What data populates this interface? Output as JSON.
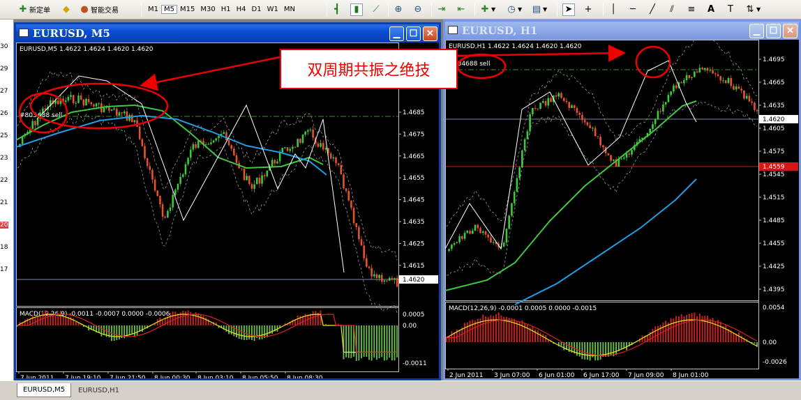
{
  "toolbar": {
    "new_order": "新定单",
    "expert": "智能交易",
    "timeframes": [
      "M1",
      "M5",
      "M15",
      "M30",
      "H1",
      "H4",
      "D1",
      "W1",
      "MN"
    ],
    "active_timeframe": "M5"
  },
  "left_strip": {
    "numbers": [
      "30",
      "29",
      "27",
      "26",
      "25",
      "23",
      "22",
      "21",
      "20",
      "18",
      "17"
    ]
  },
  "windows": [
    {
      "title": "EURUSD, M5",
      "info": "EURUSD,M5  1.4622 1.4624 1.4620 1.4620",
      "order_label": "#803",
      "order_label2": "688 sell",
      "price_axis": [
        "1.4685",
        "1.4675",
        "1.4665",
        "1.4655",
        "1.4645",
        "1.4635",
        "1.4625",
        "1.4615"
      ],
      "current_price": "1.4620",
      "macd_info": "MACD(12,26,9) -0.0011 -0.0007 0.0000 -0.0006",
      "macd_axis": [
        "0.0005",
        "0.00",
        "-0.0011"
      ],
      "time_axis": [
        "7 Jun 2011",
        "7 Jun 19:10",
        "7 Jun 21:50",
        "8 Jun 00:30",
        "8 Jun 03:10",
        "8 Jun 05:50",
        "8 Jun 08:30"
      ]
    },
    {
      "title": "EURUSD, H1",
      "info": "EURUSD,H1  1.4622 1.4624 1.4620 1.4620",
      "order_label": "034688 sell",
      "price_axis": [
        "1.4695",
        "1.4665",
        "1.4635",
        "1.4605",
        "1.4575",
        "1.4545",
        "1.4515",
        "1.4485",
        "1.4455",
        "1.4425",
        "1.4395"
      ],
      "current_price": "1.4620",
      "red_price": "1.4559",
      "macd_info": "MACD(12,26,9) -0.0001 0.0005 0.0000 -0.0015",
      "macd_axis": [
        "0.0054",
        "0.00",
        "-0.0026"
      ],
      "time_axis": [
        "2 Jun 2011",
        "3 Jun 07:00",
        "6 Jun 01:00",
        "6 Jun 17:00",
        "7 Jun 09:00",
        "8 Jun 01:00"
      ]
    }
  ],
  "annotation": "双周期共振之绝技",
  "tabs": [
    "EURUSD,M5",
    "EURUSD,H1"
  ],
  "colors": {
    "chart_bg": "#000000",
    "bull": "#3ec93e",
    "bear": "#e8532c",
    "ma_green": "#3ec93e",
    "ma_blue": "#1e9fe8",
    "annotation": "#e00000"
  }
}
